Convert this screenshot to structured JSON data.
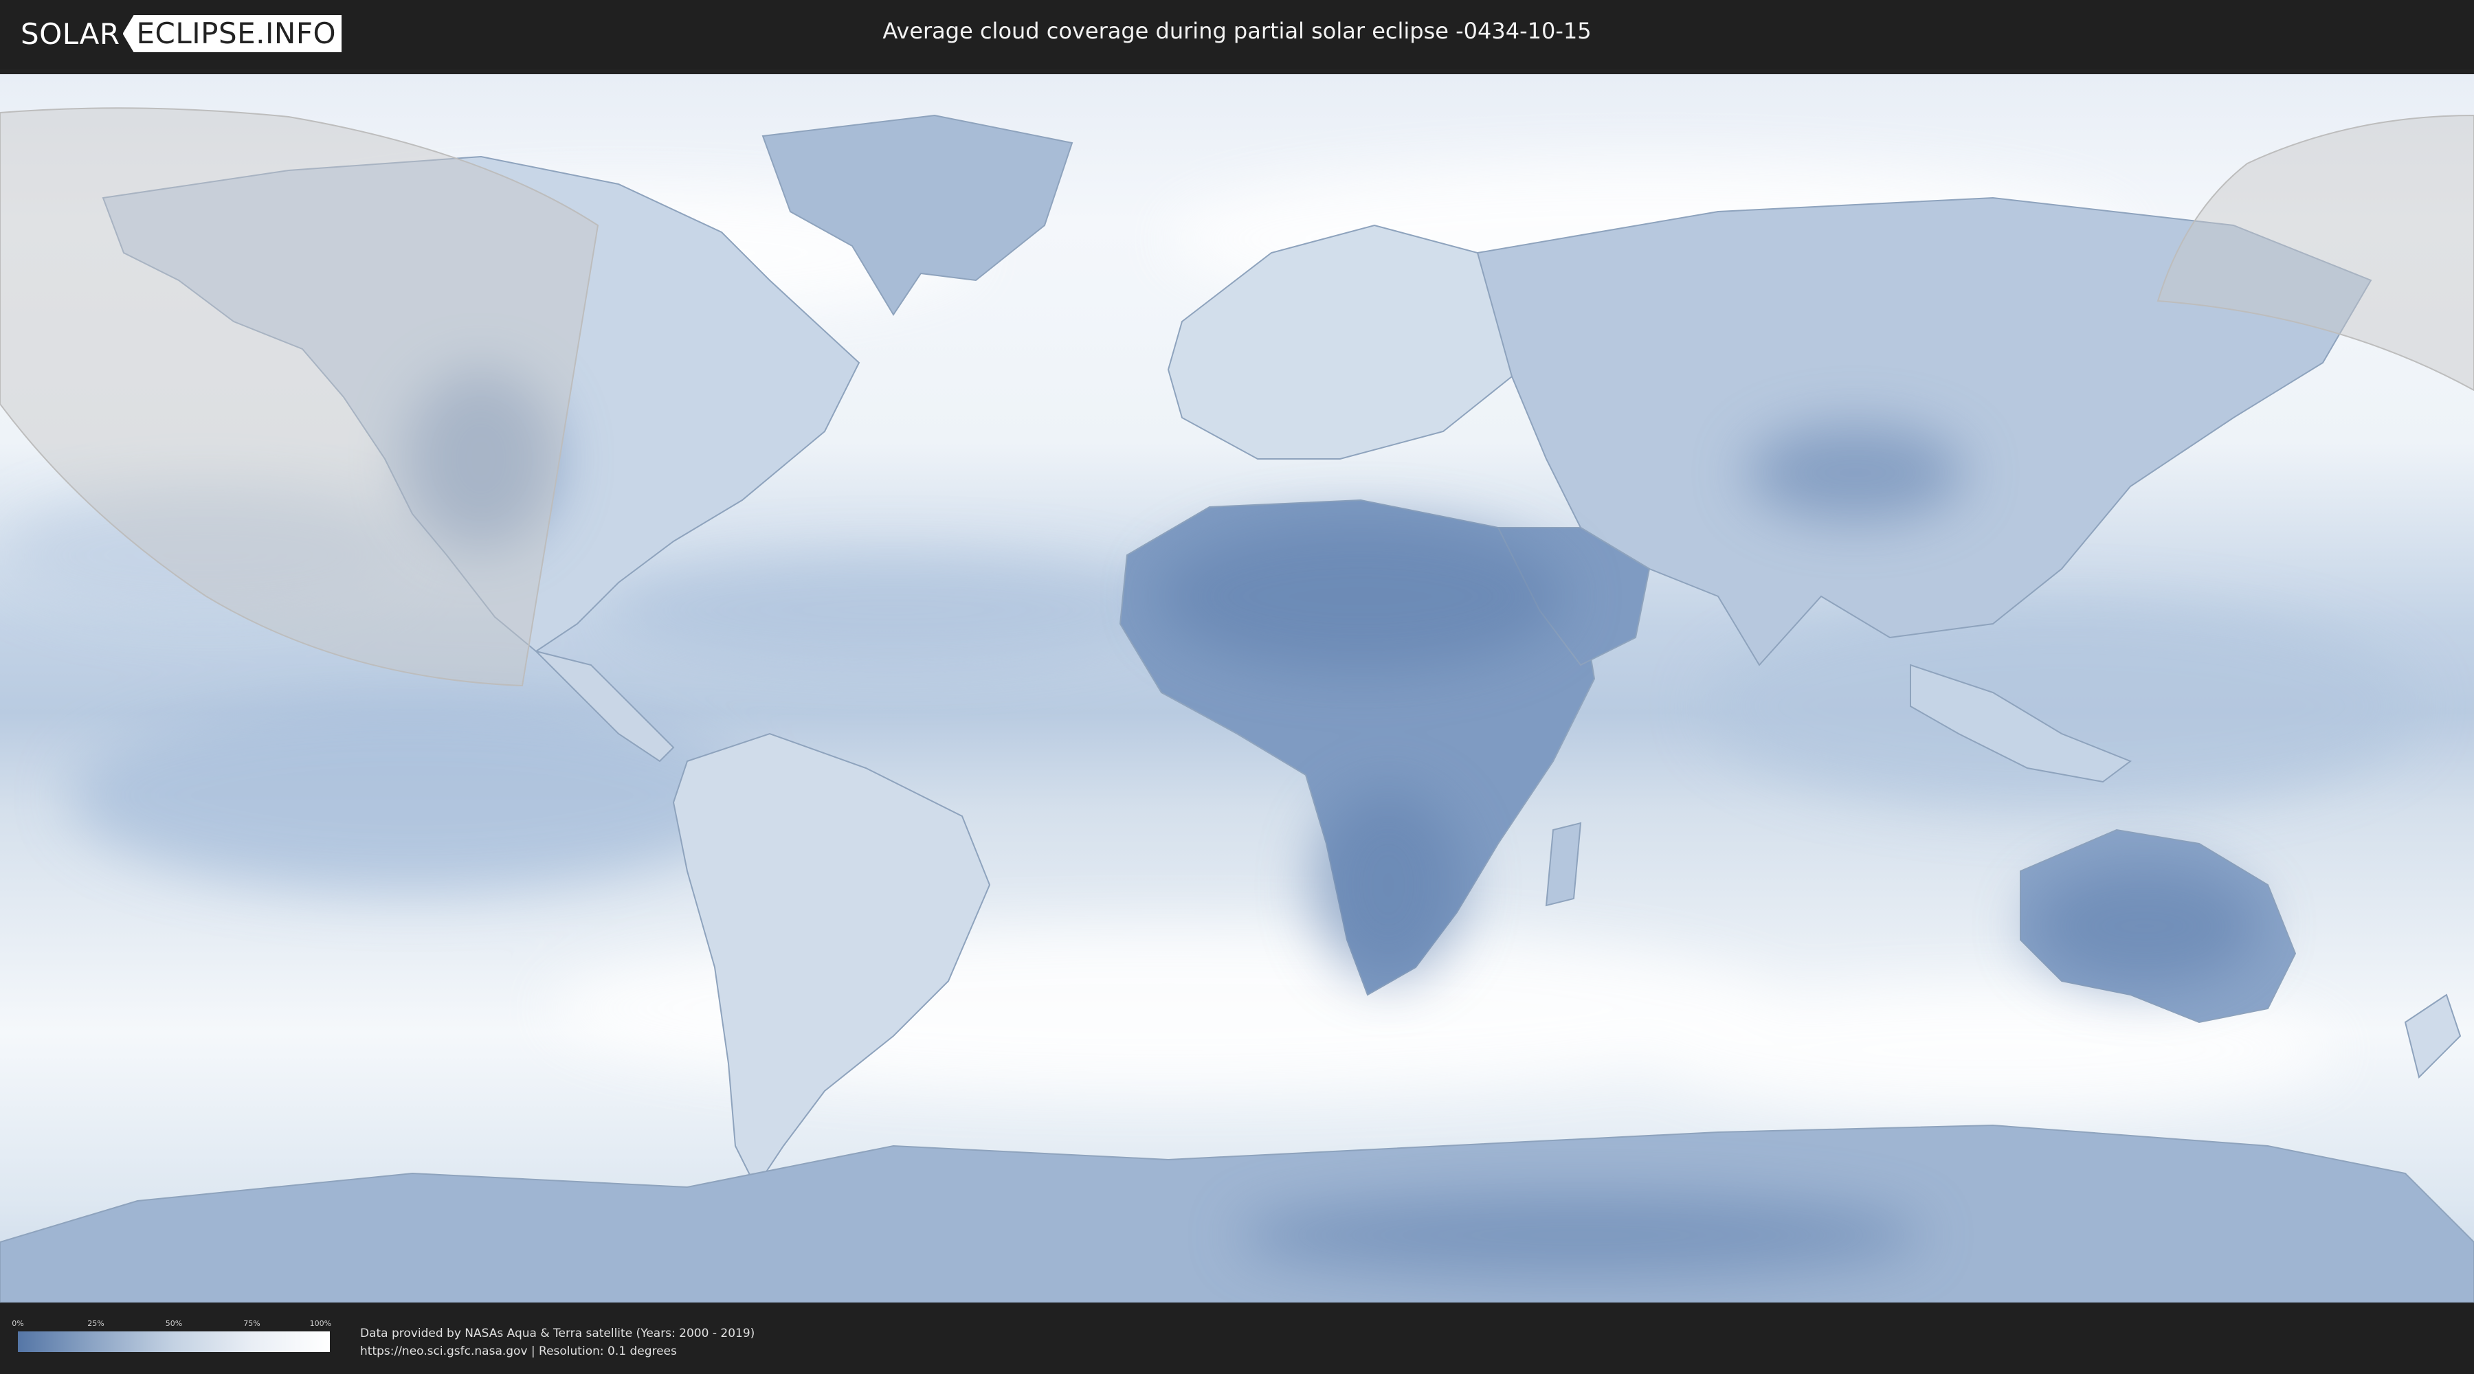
{
  "header": {
    "logo_part1": "SOLAR",
    "logo_part2": "ECLIPSE.INFO",
    "title": "Average cloud coverage during partial solar eclipse -0434-10-15"
  },
  "map": {
    "projection": "equirectangular world map",
    "content": "average cloud coverage",
    "eclipse_zone": "partial eclipse visibility area (shaded)",
    "colors": {
      "clear_sky": "#5576a6",
      "cloudy": "#ffffff",
      "eclipse_shade": "#c8c8c8",
      "header_bg": "#202020"
    }
  },
  "legend": {
    "ticks": [
      "0%",
      "25%",
      "50%",
      "75%",
      "100%"
    ]
  },
  "credits": {
    "line1": "Data provided by NASAs Aqua & Terra satellite (Years: 2000 - 2019)",
    "line2": "https://neo.sci.gsfc.nasa.gov | Resolution: 0.1 degrees"
  }
}
